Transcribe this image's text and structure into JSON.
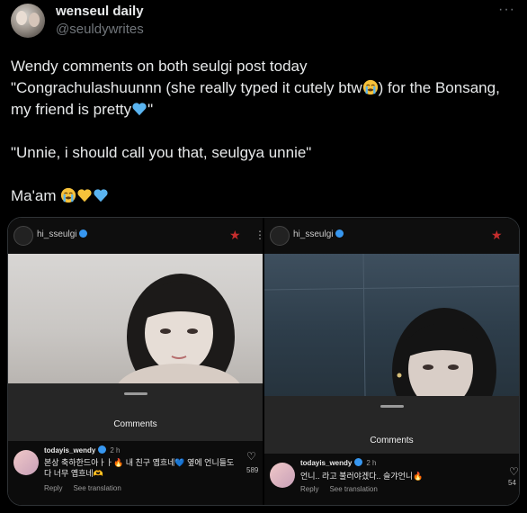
{
  "tweet": {
    "display_name": "wenseul daily",
    "handle": "@seuldywrites",
    "more_label": "···",
    "line1": "Wendy comments on both seulgi post today",
    "line2a": "\"Congrachulashuunnn (she really typed it cutely btw",
    "line2b": ") for the Bonsang, my friend is pretty",
    "line2c": "\"",
    "line3": "\"Unnie, i should call you that, seulgya unnie\"",
    "line4": "Ma'am "
  },
  "media": {
    "left": {
      "ig_username": "hi_sseulgi",
      "sheet_title": "Comments",
      "comment_user": "todayis_wendy",
      "comment_time": "2 h",
      "comment_text": "본상 축하한드아ㅏㅏ🔥 내 친구 옙흐네💙 옆에 언니들도 다 너무 옙흐네🫶",
      "reply": "Reply",
      "see_translation": "See translation",
      "likes": "589"
    },
    "right": {
      "ig_username": "hi_sseulgi",
      "sheet_title": "Comments",
      "comment_user": "todayis_wendy",
      "comment_time": "2 h",
      "comment_text": "언니.. 라고 불러야겠다.. 슬갸언니🔥",
      "reply": "Reply",
      "see_translation": "See translation",
      "likes": "54"
    }
  },
  "colors": {
    "background": "#000000",
    "text": "#e7e9ea",
    "secondary": "#71767b",
    "ig_star": "#c62d2d",
    "verified": "#3797f0"
  }
}
